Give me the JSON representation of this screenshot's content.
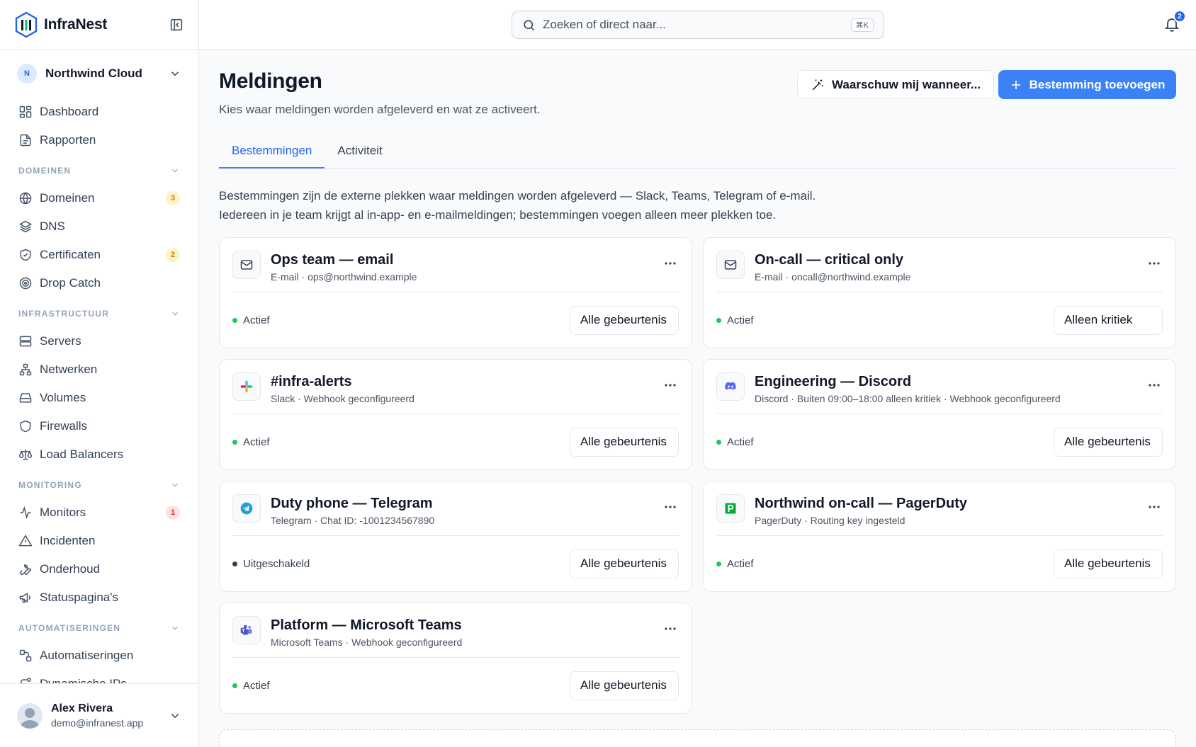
{
  "app": {
    "name": "InfraNest"
  },
  "org": {
    "initial": "N",
    "name": "Northwind Cloud"
  },
  "nav": {
    "top": [
      {
        "label": "Dashboard",
        "icon": "dashboard-icon"
      },
      {
        "label": "Rapporten",
        "icon": "report-icon"
      }
    ],
    "sections": [
      {
        "title": "DOMEINEN",
        "items": [
          {
            "label": "Domeinen",
            "icon": "globe-icon",
            "badge": "3",
            "badge_type": "warn"
          },
          {
            "label": "DNS",
            "icon": "layers-icon"
          },
          {
            "label": "Certificaten",
            "icon": "shield-check-icon",
            "badge": "2",
            "badge_type": "warn"
          },
          {
            "label": "Drop Catch",
            "icon": "target-icon"
          }
        ]
      },
      {
        "title": "INFRASTRUCTUUR",
        "items": [
          {
            "label": "Servers",
            "icon": "server-icon"
          },
          {
            "label": "Netwerken",
            "icon": "network-icon"
          },
          {
            "label": "Volumes",
            "icon": "drive-icon"
          },
          {
            "label": "Firewalls",
            "icon": "shield-icon"
          },
          {
            "label": "Load Balancers",
            "icon": "scale-icon"
          }
        ]
      },
      {
        "title": "MONITORING",
        "items": [
          {
            "label": "Monitors",
            "icon": "activity-icon",
            "badge": "1",
            "badge_type": "danger"
          },
          {
            "label": "Incidenten",
            "icon": "alert-triangle-icon"
          },
          {
            "label": "Onderhoud",
            "icon": "wrench-icon"
          },
          {
            "label": "Statuspagina's",
            "icon": "megaphone-icon"
          }
        ]
      },
      {
        "title": "AUTOMATISERINGEN",
        "items": [
          {
            "label": "Automatiseringen",
            "icon": "workflow-icon"
          },
          {
            "label": "Dynamische IPs",
            "icon": "route-icon"
          }
        ]
      }
    ]
  },
  "user": {
    "name": "Alex Rivera",
    "email": "demo@infranest.app"
  },
  "search": {
    "placeholder": "Zoeken of direct naar...",
    "shortcut": "⌘K"
  },
  "notifications": {
    "count": "2"
  },
  "page": {
    "title": "Meldingen",
    "subtitle": "Kies waar meldingen worden afgeleverd en wat ze activeert.",
    "warn_button": "Waarschuw mij wanneer...",
    "add_button": "Bestemming toevoegen",
    "tabs": [
      {
        "label": "Bestemmingen",
        "active": true
      },
      {
        "label": "Activiteit",
        "active": false
      }
    ],
    "intro_line1": "Bestemmingen zijn de externe plekken waar meldingen worden afgeleverd — Slack, Teams, Telegram of e-mail.",
    "intro_line2": "Iedereen in je team krijgt al in-app- en e-mailmeldingen; bestemmingen voegen alleen meer plekken toe."
  },
  "destinations": [
    {
      "title": "Ops team — email",
      "meta": "E-mail · ops@northwind.example",
      "icon": "mail-icon",
      "status": "Actief",
      "active": true,
      "filter": "Alle gebeurtenis"
    },
    {
      "title": "On-call — critical only",
      "meta": "E-mail · oncall@northwind.example",
      "icon": "mail-icon",
      "status": "Actief",
      "active": true,
      "filter": "Alleen kritiek"
    },
    {
      "title": "#infra-alerts",
      "meta": "Slack · Webhook geconfigureerd",
      "icon": "slack-icon",
      "status": "Actief",
      "active": true,
      "filter": "Alle gebeurtenis"
    },
    {
      "title": "Engineering — Discord",
      "meta": "Discord · Buiten 09:00–18:00 alleen kritiek · Webhook geconfigureerd",
      "icon": "discord-icon",
      "status": "Actief",
      "active": true,
      "filter": "Alle gebeurtenis"
    },
    {
      "title": "Duty phone — Telegram",
      "meta": "Telegram · Chat ID: -1001234567890",
      "icon": "telegram-icon",
      "status": "Uitgeschakeld",
      "active": false,
      "filter": "Alle gebeurtenis"
    },
    {
      "title": "Northwind on-call — PagerDuty",
      "meta": "PagerDuty · Routing key ingesteld",
      "icon": "pagerduty-icon",
      "status": "Actief",
      "active": true,
      "filter": "Alle gebeurtenis"
    },
    {
      "title": "Platform — Microsoft Teams",
      "meta": "Microsoft Teams · Webhook geconfigureerd",
      "icon": "teams-icon",
      "status": "Actief",
      "active": true,
      "filter": "Alle gebeurtenis"
    }
  ],
  "colors": {
    "accent": "#3b82f6",
    "active": "#22c55e",
    "disabled": "#334155"
  }
}
